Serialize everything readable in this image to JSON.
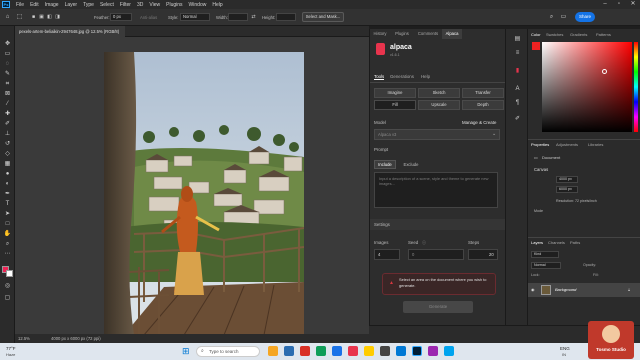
{
  "app": {
    "logo_text": "Ps",
    "menu": [
      "File",
      "Edit",
      "Image",
      "Layer",
      "Type",
      "Select",
      "Filter",
      "3D",
      "View",
      "Plugins",
      "Window",
      "Help"
    ]
  },
  "options": {
    "feather_label": "Feather:",
    "feather_value": "0 px",
    "antialias_label": "Anti-alias",
    "style_label": "Style:",
    "style_value": "Normal",
    "width_label": "Width:",
    "height_label": "Height:",
    "select_mask_label": "Select and Mask...",
    "share_label": "Share"
  },
  "document": {
    "tab_label": "pexels-artem-beliaikin-2947648.jpg @ 12.5% (RGB/8)",
    "zoom": "12.5%",
    "dimensions": "4000 px x 6000 px (72 ppi)"
  },
  "alpaca": {
    "panel_tabs": [
      "History",
      "Plugins",
      "Comments",
      "Alpaca"
    ],
    "brand": "alpaca",
    "version": "v1.6.1",
    "sub_tabs": [
      "Tools",
      "Generations",
      "Help"
    ],
    "tools": [
      "Imagine",
      "Sketch",
      "Transfer",
      "Fill",
      "Upscale",
      "Depth"
    ],
    "model_label": "Model",
    "model_value": "Alpaca v3",
    "manage_label": "Manage & Create",
    "prompt_label": "Prompt",
    "include_label": "Include",
    "exclude_label": "Exclude",
    "prompt_placeholder": "Input a description of a scene, style and theme to generate new images...",
    "settings_label": "Settings",
    "images_label": "Images",
    "images_value": "4",
    "seed_label": "Seed",
    "seed_value": "0",
    "steps_label": "Steps",
    "steps_value": "20",
    "warning_text": "Select an area on the document where you wish to generate.",
    "generate_label": "Generate"
  },
  "right_panel": {
    "color_tabs": [
      "Color",
      "Swatches",
      "Gradients",
      "Patterns"
    ],
    "props_tabs": [
      "Properties",
      "Adjustments",
      "Libraries"
    ],
    "document_label": "Document",
    "canvas_label": "Canvas",
    "w_value": "4000 px",
    "h_value": "6000 px",
    "resolution": "Resolution: 72 pixels/inch",
    "mode": "Mode",
    "layers_tabs": [
      "Layers",
      "Channels",
      "Paths"
    ],
    "layer_kind": "Kind",
    "blend_mode": "Normal",
    "opacity_label": "Opacity:",
    "lock_label": "Lock:",
    "fill_label": "Fill:",
    "layer_name": "Background"
  },
  "taskbar": {
    "weather_temp": "77°F",
    "weather_desc": "Haze",
    "search_placeholder": "Type to search",
    "lang": "ENG",
    "region": "IN",
    "channel_badge": "Tosmo Studio"
  },
  "colors": {
    "accent": "#1473e6",
    "warning": "#d7373f",
    "alpaca_brand": "#e8344d"
  }
}
